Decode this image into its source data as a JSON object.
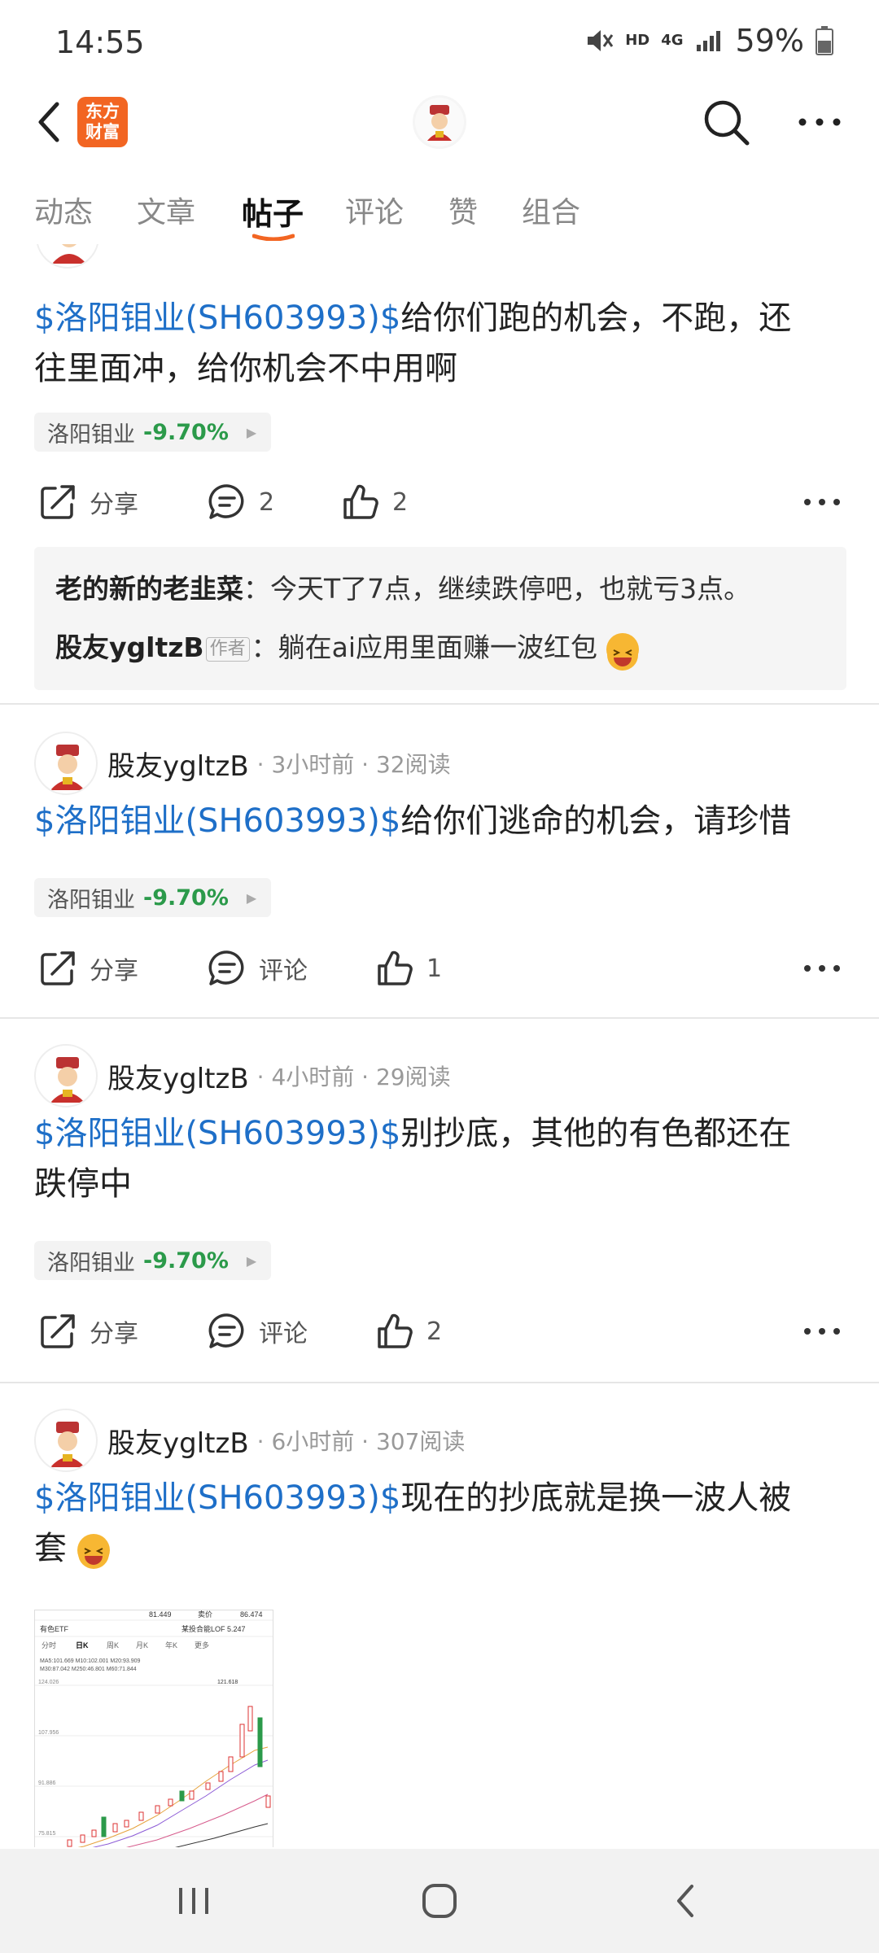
{
  "status_bar": {
    "time": "14:55",
    "network_hd": "HD",
    "network_4g": "4G",
    "battery": "59%"
  },
  "header": {
    "logo_line1": "东方",
    "logo_line2": "财富"
  },
  "tabs": [
    {
      "label": "动态",
      "active": false
    },
    {
      "label": "文章",
      "active": false
    },
    {
      "label": "帖子",
      "active": true
    },
    {
      "label": "评论",
      "active": false
    },
    {
      "label": "赞",
      "active": false
    },
    {
      "label": "组合",
      "active": false
    }
  ],
  "posts": [
    {
      "stock_link": "$洛阳钼业(SH603993)$",
      "text_line1": "给你们跑的机会，不跑，还",
      "text_line2": "往里面冲，给你机会不中用啊",
      "chip": {
        "name": "洛阳钼业",
        "change": "-9.70%"
      },
      "share_label": "分享",
      "comment_count": "2",
      "like_count": "2",
      "comments": [
        {
          "author": "老的新的老韭菜",
          "text": "：今天T了7点，继续跌停吧，也就亏3点。"
        },
        {
          "author": "股友ygltzB",
          "tag": "作者",
          "text": "：躺在ai应用里面赚一波红包"
        }
      ]
    },
    {
      "author": "股友ygltzB",
      "meta": "· 3小时前 · 32阅读",
      "stock_link": "$洛阳钼业(SH603993)$",
      "text_line1": "给你们逃命的机会，请珍惜",
      "chip": {
        "name": "洛阳钼业",
        "change": "-9.70%"
      },
      "share_label": "分享",
      "comment_label": "评论",
      "like_count": "1"
    },
    {
      "author": "股友ygltzB",
      "meta": "· 4小时前 · 29阅读",
      "stock_link": "$洛阳钼业(SH603993)$",
      "text_line1": "别抄底，其他的有色都还在",
      "text_line2": "跌停中",
      "chip": {
        "name": "洛阳钼业",
        "change": "-9.70%"
      },
      "share_label": "分享",
      "comment_label": "评论",
      "like_count": "2"
    },
    {
      "author": "股友ygltzB",
      "meta": "· 6小时前 · 307阅读",
      "stock_link": "$洛阳钼业(SH603993)$",
      "text_line1": "现在的抄底就是换一波人被",
      "text_line2": "套"
    }
  ],
  "chart_thumbnail": {
    "top_values": [
      "81.449",
      "卖价",
      "86.474"
    ],
    "fund_name": "有色ETF",
    "fund_right": "某投合能LOF  5.247",
    "tabs": [
      "分时",
      "日K",
      "周K",
      "月K",
      "年K",
      "更多"
    ],
    "ma_line": "MA5:101.669  M10:102.001  M20:93.909",
    "ma_line2": "M30:87.042  M250:46.801  M60:71.844",
    "y_labels": [
      "124.026",
      "107.956",
      "91.886",
      "75.815"
    ],
    "peak_label": "121.618"
  },
  "colors": {
    "stock_link": "#1e6fc8",
    "change_down": "#2b9a4a",
    "brand": "#f26522"
  }
}
